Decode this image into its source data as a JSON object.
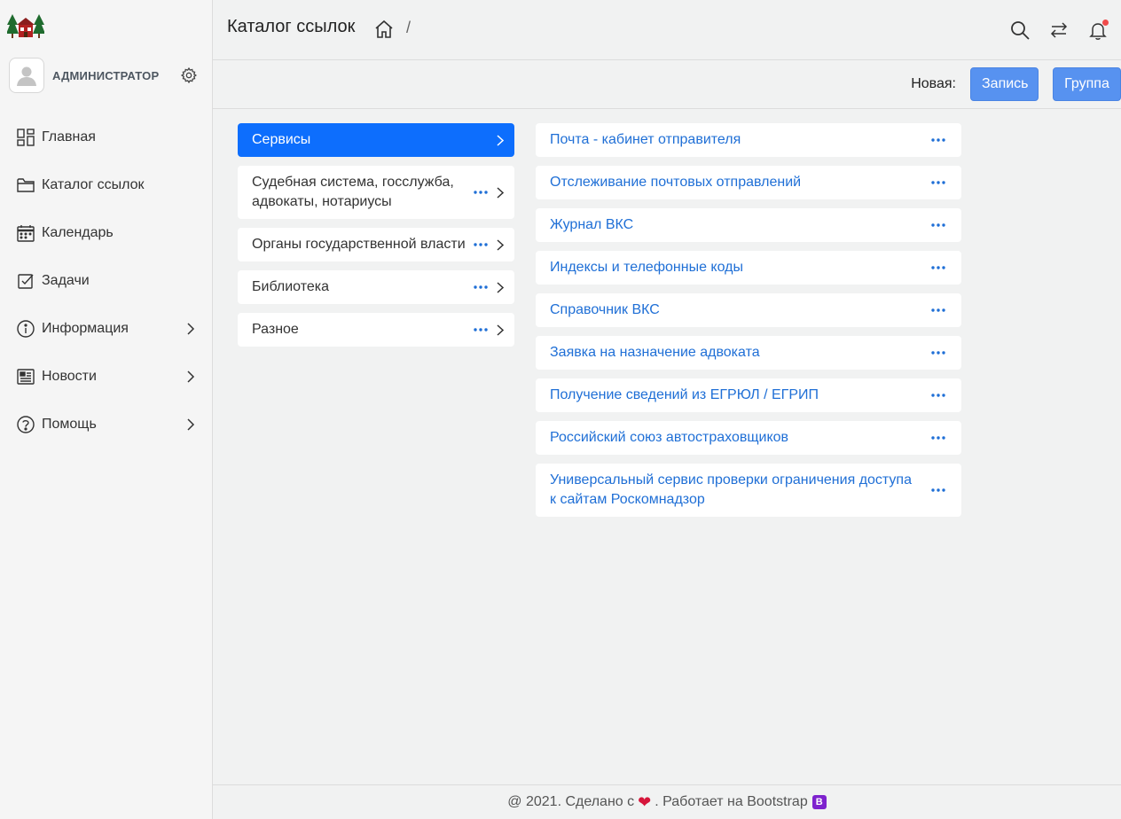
{
  "user": {
    "name": "АДМИНИСТРАТОР"
  },
  "sidebar": {
    "items": [
      {
        "label": "Главная",
        "icon": "dashboard-icon",
        "has_submenu": false
      },
      {
        "label": "Каталог ссылок",
        "icon": "folder-icon",
        "has_submenu": false
      },
      {
        "label": "Календарь",
        "icon": "calendar-icon",
        "has_submenu": false
      },
      {
        "label": "Задачи",
        "icon": "checkbox-icon",
        "has_submenu": false
      },
      {
        "label": "Информация",
        "icon": "info-icon",
        "has_submenu": true
      },
      {
        "label": "Новости",
        "icon": "newspaper-icon",
        "has_submenu": true
      },
      {
        "label": "Помощь",
        "icon": "help-icon",
        "has_submenu": true
      }
    ]
  },
  "header": {
    "title": "Каталог ссылок",
    "breadcrumb_separator": "/"
  },
  "toolbar": {
    "new_label": "Новая:",
    "record_button": "Запись",
    "group_button": "Группа"
  },
  "groups": [
    {
      "label": "Сервисы",
      "active": true
    },
    {
      "label": "Судебная система, госслужба, адвокаты, нотариусы",
      "active": false
    },
    {
      "label": "Органы государственной власти",
      "active": false
    },
    {
      "label": "Библиотека",
      "active": false
    },
    {
      "label": "Разное",
      "active": false
    }
  ],
  "links": [
    "Почта - кабинет отправителя",
    "Отслеживание почтовых отправлений",
    "Журнал ВКС",
    "Индексы и телефонные коды",
    "Справочник ВКС",
    "Заявка на назначение адвоката",
    "Получение сведений из ЕГРЮЛ / ЕГРИП",
    "Российский союз автостраховщиков",
    "Универсальный сервис проверки ограничения доступа к сайтам Роскомнадзор"
  ],
  "footer": {
    "prefix": "@ 2021. Сделано с",
    "suffix": ". Работает на Bootstrap",
    "badge": "B"
  },
  "colors": {
    "accent": "#0d6efd",
    "button": "#5792f0",
    "link": "#1f6fd6",
    "notification": "#f04b4b",
    "heart": "#d6163b",
    "bootstrap_badge": "#7e22ce"
  }
}
